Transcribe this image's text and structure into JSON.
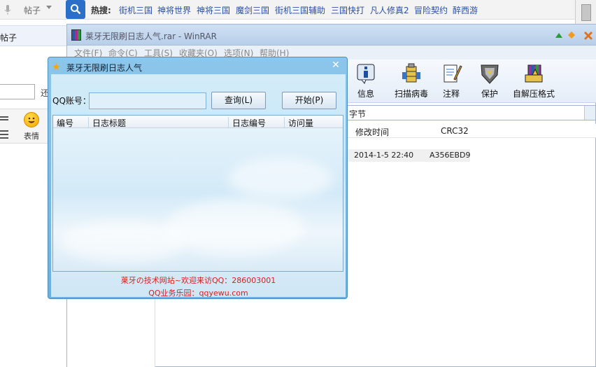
{
  "browser": {
    "search_mode": "帖子",
    "hot_label": "热搜:",
    "hot_links": [
      "街机三国",
      "神将世界",
      "神将三国",
      "魔剑三国",
      "街机三国辅助",
      "三国快打",
      "凡人修真2",
      "冒险契约",
      "醉西游"
    ],
    "left_tab": "帖子",
    "left_snippet": "还",
    "emoji_label": "表情",
    "accent": "#2c6fc8"
  },
  "winrar": {
    "title_bold": "莱牙无限刷日志人气",
    "title_suffix": ".rar - WinRAR",
    "menu": [
      "文件(F)",
      "命令(C)",
      "工具(S)",
      "收藏夹(O)",
      "选项(N)",
      "帮助(H)"
    ],
    "toolbar": [
      {
        "label": "信息",
        "icon": "info-icon"
      },
      {
        "label": "扫描病毒",
        "icon": "scan-virus-icon"
      },
      {
        "label": "注释",
        "icon": "comment-icon"
      },
      {
        "label": "保护",
        "icon": "protect-shield-icon"
      },
      {
        "label": "自解压格式",
        "icon": "sfx-icon"
      }
    ],
    "path_text": "字节",
    "columns": [
      "修改时间",
      "CRC32"
    ],
    "row": {
      "modified": "2014-1-5 22:40",
      "crc": "A356EBD9"
    }
  },
  "dialog": {
    "title": "莱牙无限刷日志人气",
    "qq_label": "QQ账号：",
    "qq_value": "",
    "query_button": "查询(L)",
    "start_button": "开始(P)",
    "columns": [
      "编号",
      "日志标题",
      "日志编号",
      "访问量"
    ],
    "footer_line1": "莱牙の技术网站~欢迎来访QQ：286003001",
    "footer_line2": "QQ业务乐园：qqyewu.com",
    "footer_color": "#d42020"
  }
}
